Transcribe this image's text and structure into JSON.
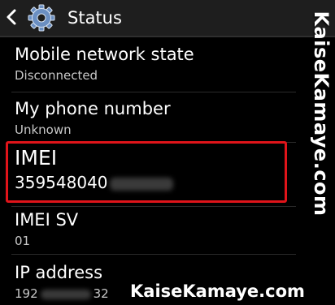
{
  "header": {
    "title": "Status",
    "back_icon": "chevron-left-icon",
    "settings_icon": "gear-icon"
  },
  "items": [
    {
      "title": "Mobile network state",
      "value": "Disconnected"
    },
    {
      "title": "My phone number",
      "value": "Unknown"
    },
    {
      "title": "IMEI",
      "value": "359548040"
    },
    {
      "title": "IMEI SV",
      "value": "01"
    },
    {
      "title": "IP address",
      "value_prefix": "192",
      "value_suffix": "32"
    }
  ],
  "watermark": {
    "side": "KaiseKamaye.com",
    "bottom": "KaiseKamaye.com"
  },
  "colors": {
    "highlight": "#e0141a",
    "gear": "#6b8fc2"
  }
}
